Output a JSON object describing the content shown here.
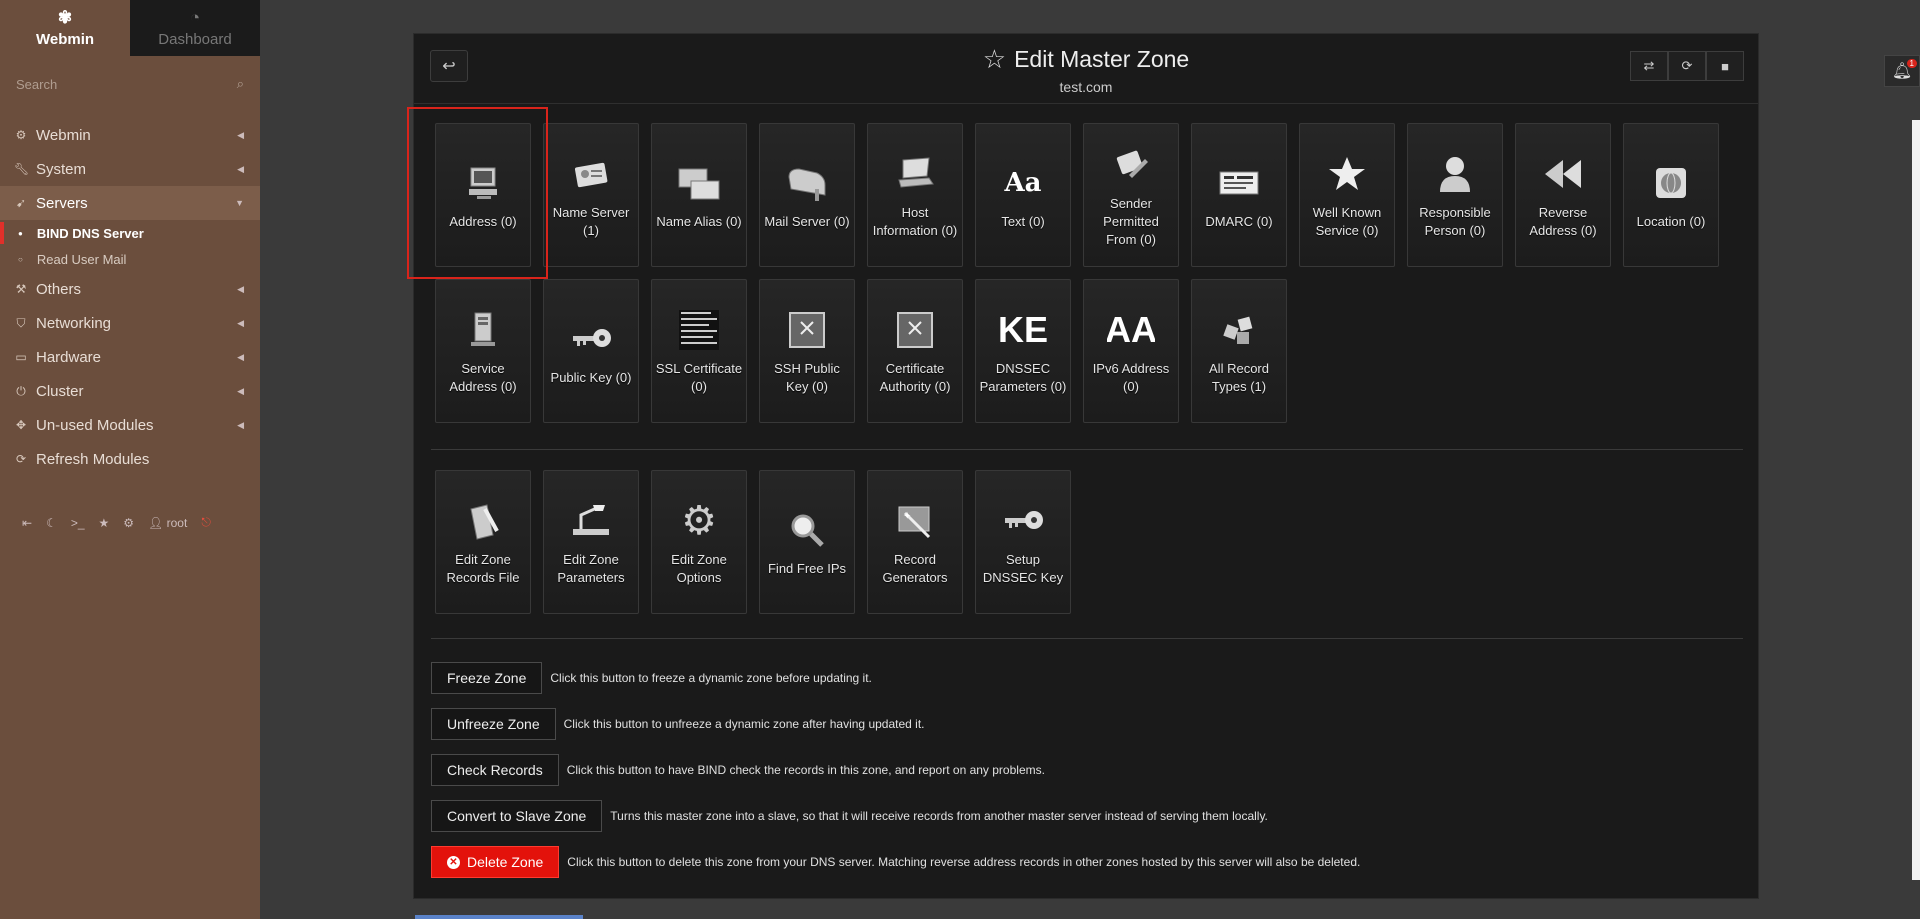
{
  "sidebar": {
    "tabs": [
      {
        "label": "Webmin",
        "icon": "webmin-logo-icon"
      },
      {
        "label": "Dashboard",
        "icon": "dashboard-icon"
      }
    ],
    "search_placeholder": "Search",
    "menu": [
      {
        "label": "Webmin",
        "icon": "gear-icon"
      },
      {
        "label": "System",
        "icon": "wrench-icon"
      },
      {
        "label": "Servers",
        "icon": "rocket-icon"
      },
      {
        "label": "Others",
        "icon": "tools-icon"
      },
      {
        "label": "Networking",
        "icon": "shield-icon"
      },
      {
        "label": "Hardware",
        "icon": "hdd-icon"
      },
      {
        "label": "Cluster",
        "icon": "power-icon"
      },
      {
        "label": "Un-used Modules",
        "icon": "puzzle-icon"
      },
      {
        "label": "Refresh Modules",
        "icon": "refresh-icon"
      }
    ],
    "sub_items": [
      {
        "label": "BIND DNS Server"
      },
      {
        "label": "Read User Mail"
      }
    ],
    "footer_user": "root"
  },
  "header": {
    "title": "Edit Master Zone",
    "subtitle": "test.com"
  },
  "record_tiles": [
    "Address (0)",
    "Name Server (1)",
    "Name Alias (0)",
    "Mail Server (0)",
    "Host Information (0)",
    "Text (0)",
    "Sender Permitted From (0)",
    "DMARC (0)",
    "Well Known Service (0)",
    "Responsible Person (0)",
    "Reverse Address (0)",
    "Location (0)",
    "Service Address (0)",
    "Public Key (0)",
    "SSL Certificate (0)",
    "SSH Public Key (0)",
    "Certificate Authority (0)",
    "DNSSEC Parameters (0)",
    "IPv6 Address (0)",
    "All Record Types (1)"
  ],
  "tool_tiles": [
    "Edit Zone Records File",
    "Edit Zone Parameters",
    "Edit Zone Options",
    "Find Free IPs",
    "Record Generators",
    "Setup DNSSEC Key"
  ],
  "actions": [
    {
      "label": "Freeze Zone",
      "desc": "Click this button to freeze a dynamic zone before updating it."
    },
    {
      "label": "Unfreeze Zone",
      "desc": "Click this button to unfreeze a dynamic zone after having updated it."
    },
    {
      "label": "Check Records",
      "desc": "Click this button to have BIND check the records in this zone, and report on any problems."
    },
    {
      "label": "Convert to Slave Zone",
      "desc": "Turns this master zone into a slave, so that it will receive records from another master server instead of serving them locally."
    },
    {
      "label": "Delete Zone",
      "desc": "Click this button to delete this zone from your DNS server. Matching reverse address records in other zones hosted by this server will also be deleted."
    }
  ],
  "icon_text": {
    "text_glyph": "Aa",
    "dnssec_glyph": "KE",
    "ipv6_glyph": "AA"
  },
  "notification_count": "1",
  "colors": {
    "sidebar": "#6b4e3d",
    "danger": "#e3120b",
    "highlight": "#d9241b"
  }
}
